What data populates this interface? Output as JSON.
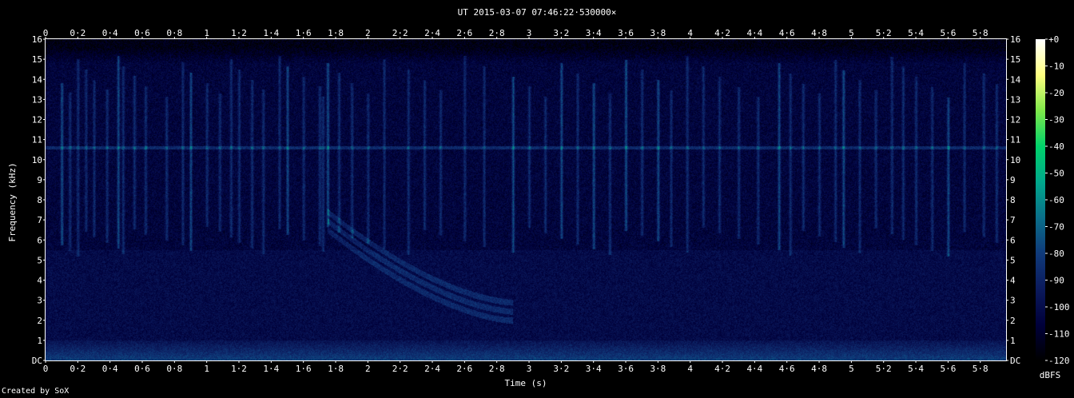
{
  "chart_data": {
    "type": "heatmap",
    "title": "UT 2015-03-07 07:46:22·530000×",
    "xlabel": "Time (s)",
    "ylabel": "Frequency (kHz)",
    "credit": "Created by SoX",
    "colorbar_label": "dBFS",
    "xlim": [
      0,
      5.96
    ],
    "ylim": [
      0,
      16
    ],
    "x_ticks": [
      "0",
      "0·2",
      "0·4",
      "0·6",
      "0·8",
      "1",
      "1·2",
      "1·4",
      "1·6",
      "1·8",
      "2",
      "2·2",
      "2·4",
      "2·6",
      "2·8",
      "3",
      "3·2",
      "3·4",
      "3·6",
      "3·8",
      "4",
      "4·2",
      "4·4",
      "4·6",
      "4·8",
      "5",
      "5·2",
      "5·4",
      "5·6",
      "5·8"
    ],
    "y_ticks": [
      "DC",
      "1",
      "2",
      "3",
      "4",
      "5",
      "6",
      "7",
      "8",
      "9",
      "10",
      "11",
      "12",
      "13",
      "14",
      "15",
      "16"
    ],
    "colorbar_ticks": [
      "+0",
      "-10",
      "-20",
      "-30",
      "-40",
      "-50",
      "-60",
      "-70",
      "-80",
      "-90",
      "-100",
      "-110",
      "-120"
    ],
    "colorbar_range": [
      -120,
      0
    ],
    "background_level_dbfs": -105,
    "features": {
      "constant_tone_khz": 10.6,
      "low_band_khz": [
        0,
        1.0
      ],
      "whistler": {
        "t_start": 1.75,
        "t_end": 2.9,
        "f_start_khz": 6.5,
        "f_end_khz": 2.0
      },
      "spikes_s": [
        0.1,
        0.15,
        0.2,
        0.25,
        0.3,
        0.38,
        0.45,
        0.48,
        0.55,
        0.62,
        0.75,
        0.85,
        0.9,
        1.0,
        1.08,
        1.15,
        1.2,
        1.28,
        1.35,
        1.45,
        1.5,
        1.6,
        1.7,
        1.72,
        1.75,
        1.82,
        1.9,
        2.0,
        2.1,
        2.25,
        2.35,
        2.45,
        2.6,
        2.72,
        2.9,
        3.0,
        3.1,
        3.2,
        3.3,
        3.4,
        3.5,
        3.6,
        3.7,
        3.8,
        3.88,
        3.98,
        4.08,
        4.18,
        4.3,
        4.42,
        4.55,
        4.62,
        4.7,
        4.8,
        4.9,
        4.95,
        5.05,
        5.15,
        5.25,
        5.32,
        5.4,
        5.5,
        5.6,
        5.7,
        5.82,
        5.9
      ],
      "strong_spikes_s": [
        0.1,
        0.45,
        0.9,
        1.18,
        1.5,
        1.75,
        2.9,
        3.2,
        3.4,
        3.6,
        3.8,
        4.55,
        4.95,
        5.6
      ]
    }
  },
  "colors": {
    "background": "#000000",
    "text": "#ffffff",
    "colormap": [
      "#000000",
      "#00003a",
      "#0b1a5c",
      "#0f3a7a",
      "#0a6f8a",
      "#00a88c",
      "#00d26a",
      "#7fe84a",
      "#ffff80",
      "#ffffff"
    ]
  }
}
